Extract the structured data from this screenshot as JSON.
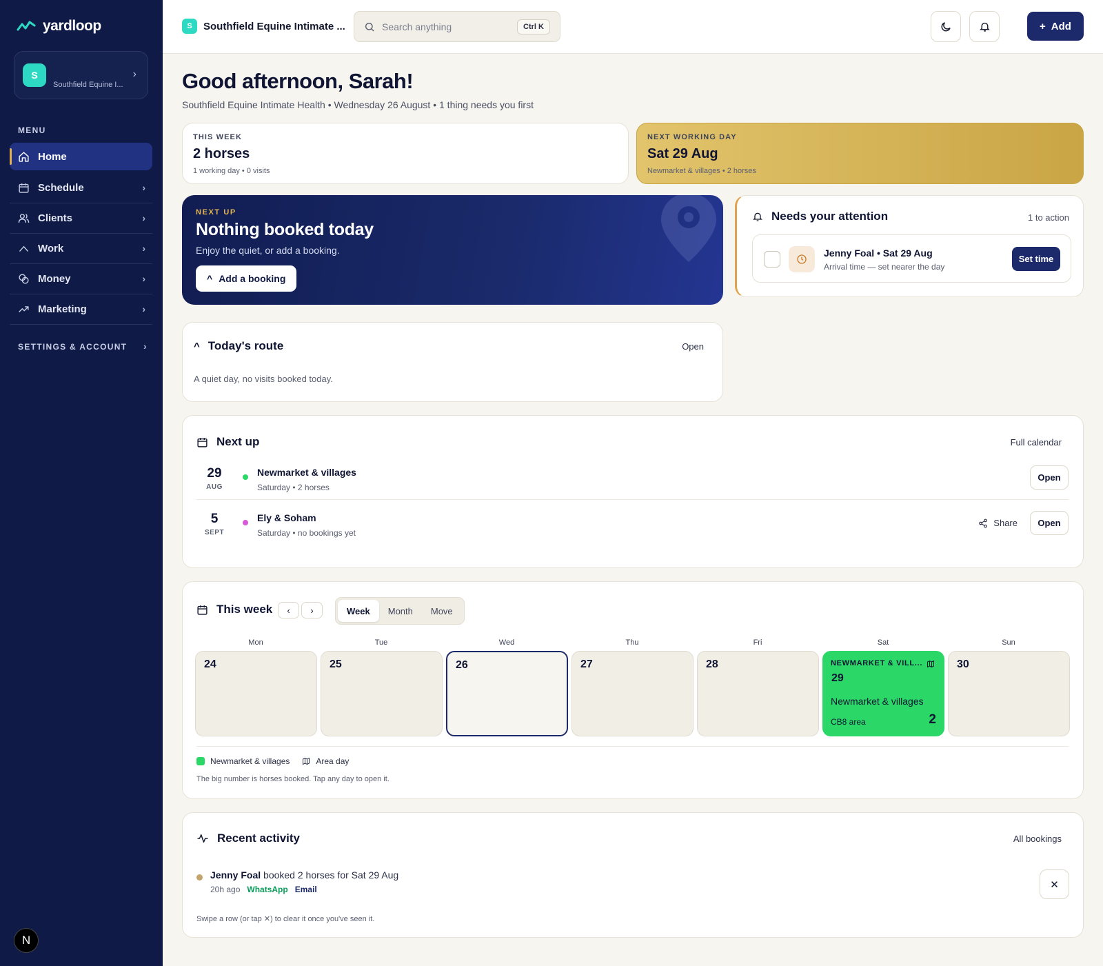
{
  "brand": {
    "name": "yardloop"
  },
  "org": {
    "avatar": "S",
    "name": "Southfield Equine I..."
  },
  "sidebar": {
    "menu_heading": "MENU",
    "items": [
      {
        "label": "Home",
        "icon": "home-icon",
        "active": true
      },
      {
        "label": "Schedule",
        "icon": "calendar-icon"
      },
      {
        "label": "Clients",
        "icon": "users-icon"
      },
      {
        "label": "Work",
        "icon": "work-icon"
      },
      {
        "label": "Money",
        "icon": "money-icon"
      },
      {
        "label": "Marketing",
        "icon": "trend-icon"
      }
    ],
    "settings_label": "SETTINGS & ACCOUNT",
    "dev_badge": "N"
  },
  "topbar": {
    "workspace_avatar": "S",
    "workspace_name": "Southfield Equine Intimate ...",
    "search_placeholder": "Search anything",
    "search_shortcut": "Ctrl K",
    "add_label": "Add"
  },
  "greeting": {
    "title": "Good afternoon, Sarah!",
    "subtitle": "Southfield Equine Intimate Health • Wednesday 26 August • 1 thing needs you first"
  },
  "stats": {
    "this_week": {
      "eyebrow": "THIS WEEK",
      "title": "2 horses",
      "sub": "1 working day • 0 visits"
    },
    "next_day": {
      "eyebrow": "NEXT WORKING DAY",
      "title": "Sat 29 Aug",
      "sub": "Newmarket & villages • 2 horses"
    }
  },
  "hero": {
    "eyebrow": "NEXT UP",
    "title": "Nothing booked today",
    "subtitle": "Enjoy the quiet, or add a booking.",
    "button": "Add a booking"
  },
  "attention": {
    "title": "Needs your attention",
    "meta": "1 to action",
    "task": {
      "title": "Jenny Foal • Sat 29 Aug",
      "sub": "Arrival time — set nearer the day",
      "button": "Set time"
    }
  },
  "route": {
    "title": "Today's route",
    "open": "Open",
    "body": "A quiet day, no visits booked today."
  },
  "next_up": {
    "title": "Next up",
    "link": "Full calendar",
    "rows": [
      {
        "day": "29",
        "month": "AUG",
        "title": "Newmarket & villages",
        "sub": "Saturday • 2 horses",
        "dot": "#2bd867",
        "open": "Open"
      },
      {
        "day": "5",
        "month": "SEPT",
        "title": "Ely & Soham",
        "sub": "Saturday • no bookings yet",
        "dot": "#d65ad6",
        "open": "Open",
        "share": "Share"
      }
    ]
  },
  "this_week": {
    "title": "This week",
    "prev": "‹",
    "next": "›",
    "views": [
      "Week",
      "Month",
      "Move"
    ],
    "selected_view": "Week",
    "days": [
      {
        "dow": "Mon",
        "date": "24"
      },
      {
        "dow": "Tue",
        "date": "25"
      },
      {
        "dow": "Wed",
        "date": "26",
        "today": true
      },
      {
        "dow": "Thu",
        "date": "27"
      },
      {
        "dow": "Fri",
        "date": "28"
      },
      {
        "dow": "Sat",
        "date": "29",
        "tag": "NEWMARKET & VILL...",
        "place": "Newmarket & villages",
        "area": "CB8 area",
        "count": "2"
      },
      {
        "dow": "Sun",
        "date": "30"
      }
    ],
    "legend_area": "Newmarket & villages",
    "legend_area_day": "Area day",
    "note": "The big number is horses booked. Tap any day to open it."
  },
  "activity": {
    "title": "Recent activity",
    "link": "All bookings",
    "item": {
      "who": "Jenny Foal",
      "text": " booked 2 horses for Sat 29 Aug",
      "time": "20h ago",
      "channel1": "WhatsApp",
      "channel2": "Email",
      "dismiss": "✕"
    },
    "note": "Swipe a row (or tap ✕) to clear it once you've seen it."
  },
  "colors": {
    "sidebar": "#0f1a47",
    "accent": "#1c2a6b",
    "gold": "#e3b04b",
    "green": "#2bd867"
  }
}
